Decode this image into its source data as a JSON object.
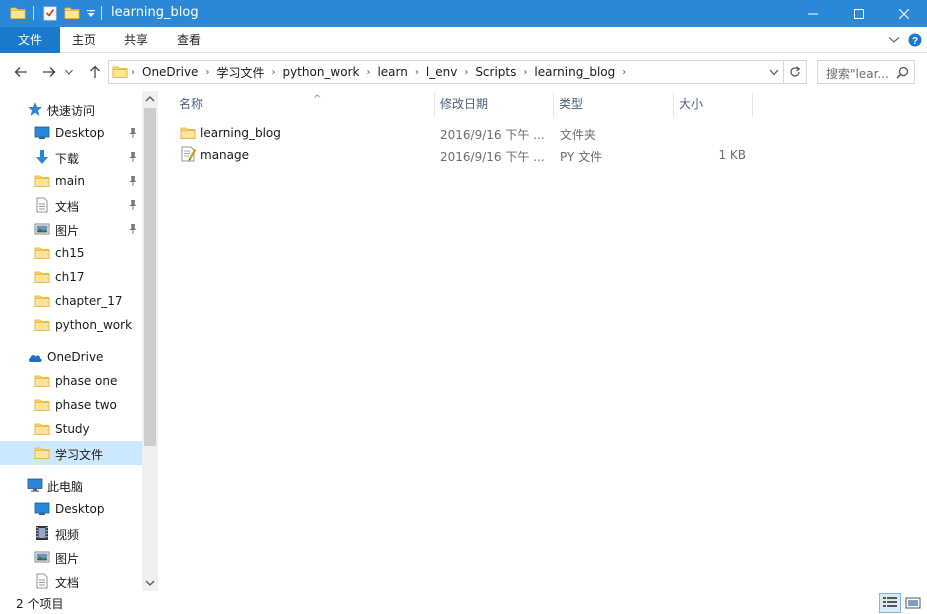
{
  "window": {
    "title": "learning_blog"
  },
  "ribbon": {
    "tabs": [
      "文件",
      "主页",
      "共享",
      "查看"
    ]
  },
  "address": {
    "breadcrumbs": [
      "OneDrive",
      "学习文件",
      "python_work",
      "learn",
      "l_env",
      "Scripts",
      "learning_blog"
    ]
  },
  "search": {
    "placeholder": "搜索\"lear..."
  },
  "nav": {
    "quick_access_label": "快速访问",
    "quick_items": [
      {
        "label": "Desktop",
        "icon": "desktop-icon",
        "pinned": true
      },
      {
        "label": "下载",
        "icon": "download-icon",
        "pinned": true
      },
      {
        "label": "main",
        "icon": "folder-icon",
        "pinned": true
      },
      {
        "label": "文档",
        "icon": "document-icon",
        "pinned": true
      },
      {
        "label": "图片",
        "icon": "picture-icon",
        "pinned": true
      },
      {
        "label": "ch15",
        "icon": "folder-icon",
        "pinned": false
      },
      {
        "label": "ch17",
        "icon": "folder-icon",
        "pinned": false
      },
      {
        "label": "chapter_17",
        "icon": "folder-icon",
        "pinned": false
      },
      {
        "label": "python_work",
        "icon": "folder-icon",
        "pinned": false
      }
    ],
    "onedrive_label": "OneDrive",
    "onedrive_items": [
      {
        "label": "phase one"
      },
      {
        "label": "phase two"
      },
      {
        "label": "Study"
      },
      {
        "label": "学习文件",
        "selected": true
      }
    ],
    "thispc_label": "此电脑",
    "thispc_items": [
      {
        "label": "Desktop",
        "icon": "desktop-icon"
      },
      {
        "label": "视频",
        "icon": "video-icon"
      },
      {
        "label": "图片",
        "icon": "picture-icon"
      },
      {
        "label": "文档",
        "icon": "document-icon"
      }
    ]
  },
  "columns": {
    "name": "名称",
    "date": "修改日期",
    "type": "类型",
    "size": "大小"
  },
  "files": [
    {
      "name": "learning_blog",
      "date": "2016/9/16 下午 ...",
      "type": "文件夹",
      "size": "",
      "icon": "folder-icon"
    },
    {
      "name": "manage",
      "date": "2016/9/16 下午 ...",
      "type": "PY 文件",
      "size": "1 KB",
      "icon": "python-file-icon"
    }
  ],
  "status": {
    "item_count": "2 个项目"
  },
  "colors": {
    "titlebar": "#2b88d8",
    "file_tab": "#1979ca",
    "selected": "#cce8ff",
    "folder": "#ffd76b"
  }
}
